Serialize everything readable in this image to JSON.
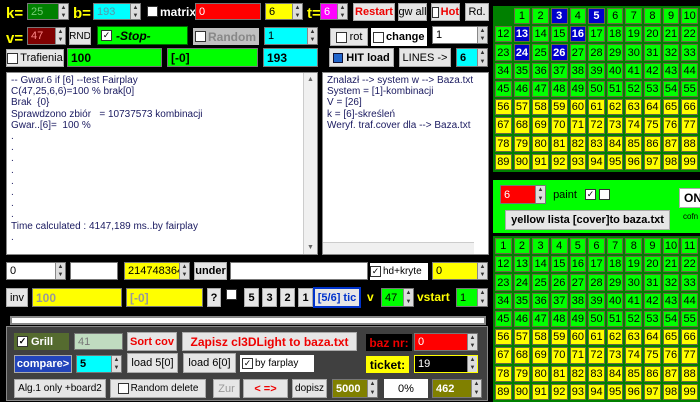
{
  "colors": {
    "green": "#00ff00",
    "yellow": "#ffff00",
    "gray": "#c0c0c0",
    "blue": "#0000cc",
    "red": "#ff0000",
    "magenta": "#ff00ff",
    "cyan": "#00ffff"
  },
  "top": {
    "k_label": "k=",
    "k_value": "25",
    "b_label": "b=",
    "b_value": "193",
    "matrix_label": "matrix",
    "red_value": "0",
    "six_value": "6",
    "t_label": "t=",
    "t_value": "6",
    "restart_label": "Restart",
    "gwall_label": "gw all",
    "hot_label": "Hot",
    "rd_label": "Rd."
  },
  "row2": {
    "v_label": "v=",
    "v_value": "47",
    "rnd_label": "RND",
    "stop_label": "-Stop-",
    "random_label": "Random",
    "cyan_value": "1",
    "rot_label": "rot",
    "change_label": "change",
    "change_value": "1"
  },
  "row3": {
    "trafienia_label": "Trafienia",
    "val100": "100",
    "bracket0": "[-0]",
    "val193": "193",
    "hitload_label": "HIT load",
    "lines_label": "LINES ->",
    "lines_value": "6"
  },
  "memo_left": [
    "-- Gwar.6 if [6] --test Fairplay",
    "C(47,25,6,6)=100 % brak[0]",
    "Brak  {0}",
    "Sprawdzono zbiór   = 10737573 kombinacji",
    "Gwar..[6]=  100 %",
    ".",
    ".",
    ".",
    ".",
    ".",
    ".",
    ".",
    ".",
    "Time calculated : 4147,189 ms..by fairplay",
    "."
  ],
  "memo_right": [
    "Znalazł --> system w --> Baza.txt",
    "System = [1]-kombinacji",
    "V = [26]",
    "k = [6]-skreśleń",
    "Weryf. traf.cover dla --> Baza.txt"
  ],
  "row4": {
    "zero_value": "0",
    "int_value": "214748364",
    "under_label": "under",
    "hdkryte_label": "hd+kryte",
    "yellow0": "0"
  },
  "row5": {
    "inv_label": "inv",
    "yellow100": "100",
    "bracket0": "[-0]",
    "q_label": "?",
    "n5": "5",
    "n3": "3",
    "n2": "2",
    "n1": "1",
    "tic_label": "[5/6] tic",
    "v_label": "v",
    "v_value": "47",
    "vstart_label": "vstart",
    "vstart_value": "1"
  },
  "bottom": {
    "grill_label": "Grill",
    "val41": "41",
    "sortcov_label": "Sort cov",
    "zapisz_label": "Zapisz cl3DLight to baza.txt",
    "baznr_label": "baz nr:",
    "baznr_value": "0",
    "compare_label": "compare>",
    "compare_value": "5",
    "load5_label": "load 5[0]",
    "load6_label": "load 6[0]",
    "byfairplay_label": "by farplay",
    "ticket_label": "ticket:",
    "ticket_value": "19",
    "alg_label": "Alg.1 only +board2",
    "randomdel_label": "Random delete",
    "zur_label": "Zur",
    "arrows_label": "< =>",
    "dopisz_label": "dopisz",
    "val5000": "5000",
    "pct_label": "0%",
    "val462": "462"
  },
  "right_mid": {
    "six_value": "6",
    "paint_label": "paint",
    "on_label": "ON",
    "cofn_label": "cofn",
    "yellow_lista_label": "yellow lista [cover]to baza.txt"
  },
  "grid_top": [
    [
      "1",
      "2",
      "3",
      "4",
      "5",
      "6",
      "7",
      "8",
      "9",
      "10"
    ],
    [
      "12",
      "13",
      "14",
      "15",
      "16",
      "17",
      "18",
      "19",
      "20",
      "21",
      "22"
    ],
    [
      "23",
      "24",
      "25",
      "26",
      "27",
      "28",
      "29",
      "30",
      "31",
      "32",
      "33"
    ],
    [
      "34",
      "35",
      "36",
      "37",
      "38",
      "39",
      "40",
      "41",
      "42",
      "43",
      "44"
    ],
    [
      "45",
      "46",
      "47",
      "48",
      "49",
      "50",
      "51",
      "52",
      "53",
      "54",
      "55"
    ],
    [
      "56",
      "57",
      "58",
      "59",
      "60",
      "61",
      "62",
      "63",
      "64",
      "65",
      "66"
    ],
    [
      "67",
      "68",
      "69",
      "70",
      "71",
      "72",
      "73",
      "74",
      "75",
      "76",
      "77"
    ],
    [
      "78",
      "79",
      "80",
      "81",
      "82",
      "83",
      "84",
      "85",
      "86",
      "87",
      "88"
    ],
    [
      "89",
      "90",
      "91",
      "92",
      "93",
      "94",
      "95",
      "96",
      "97",
      "98",
      "99"
    ]
  ],
  "grid_top_blue": [
    "3",
    "5",
    "13",
    "16",
    "24",
    "26"
  ],
  "grid_bottom": [
    [
      "1",
      "2",
      "3",
      "4",
      "5",
      "6",
      "7",
      "8",
      "9",
      "10",
      "11"
    ],
    [
      "12",
      "13",
      "14",
      "15",
      "16",
      "17",
      "18",
      "19",
      "20",
      "21",
      "22"
    ],
    [
      "23",
      "24",
      "25",
      "26",
      "27",
      "28",
      "29",
      "30",
      "31",
      "32",
      "33"
    ],
    [
      "34",
      "35",
      "36",
      "37",
      "38",
      "39",
      "40",
      "41",
      "42",
      "43",
      "44"
    ],
    [
      "45",
      "46",
      "47",
      "48",
      "49",
      "50",
      "51",
      "52",
      "53",
      "54",
      "55"
    ],
    [
      "56",
      "57",
      "58",
      "59",
      "60",
      "61",
      "62",
      "63",
      "64",
      "65",
      "66"
    ],
    [
      "67",
      "68",
      "69",
      "70",
      "71",
      "72",
      "73",
      "74",
      "75",
      "76",
      "77"
    ],
    [
      "78",
      "79",
      "80",
      "81",
      "82",
      "83",
      "84",
      "85",
      "86",
      "87",
      "88"
    ],
    [
      "89",
      "90",
      "91",
      "92",
      "93",
      "94",
      "95",
      "96",
      "97",
      "98",
      "99"
    ]
  ]
}
